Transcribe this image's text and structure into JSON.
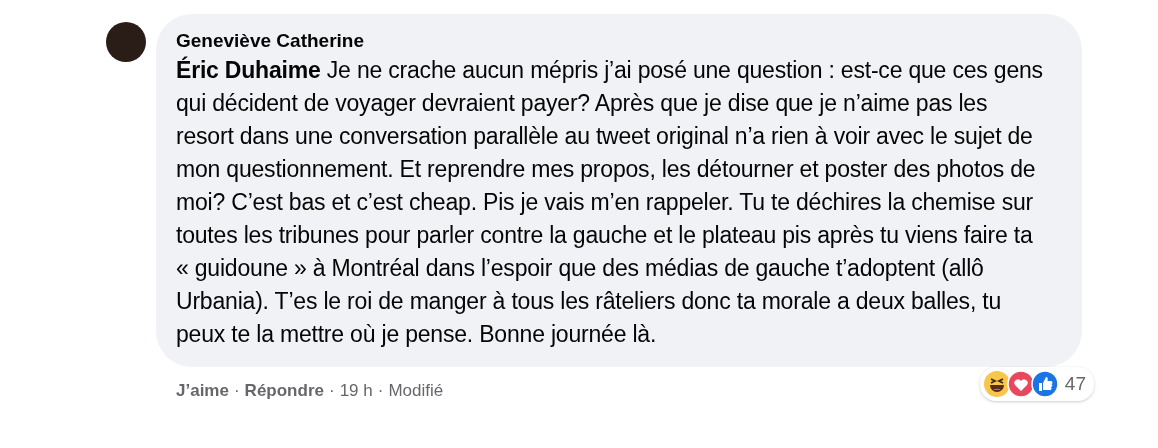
{
  "comment": {
    "author": "Geneviève Catherine",
    "mention": "Éric Duhaime",
    "text": "Je ne crache aucun mépris j’ai posé une question : est-ce que ces gens qui décident de voyager devraient payer? Après que je dise que je n’aime pas les resort dans une conversation parallèle au tweet original n’a rien à voir avec le sujet de mon questionnement. Et reprendre mes propos, les détourner et poster des photos de moi? C’est bas et c’est cheap. Pis je vais m’en rappeler. Tu te déchires la chemise sur toutes les tribunes pour parler contre la gauche et le plateau pis après tu viens faire ta « guidoune » à Montréal dans l’espoir que des médias de gauche t’adoptent (allô Urbania). T’es le roi de manger à tous les râteliers donc ta morale a deux balles, tu peux te la mettre où je pense. Bonne journée là.",
    "reactions": [
      {
        "kind": "haha"
      },
      {
        "kind": "love"
      },
      {
        "kind": "like"
      }
    ],
    "reaction_count": "47",
    "separator": "·",
    "actions": [
      {
        "label": "J’aime",
        "kind": "link"
      },
      {
        "label": "Répondre",
        "kind": "link"
      },
      {
        "label": "19 h",
        "kind": "meta"
      },
      {
        "label": "Modifié",
        "kind": "meta"
      }
    ]
  }
}
